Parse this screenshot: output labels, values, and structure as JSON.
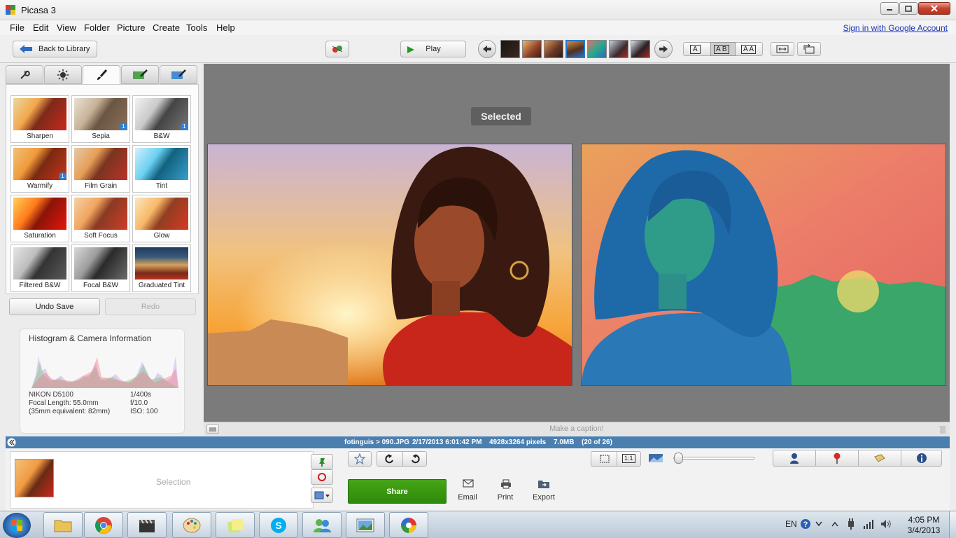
{
  "window": {
    "title": "Picasa 3"
  },
  "menu": {
    "items": [
      "File",
      "Edit",
      "View",
      "Folder",
      "Picture",
      "Create",
      "Tools",
      "Help"
    ],
    "sign_in": "Sign in with Google Account"
  },
  "toolbar": {
    "back_label": "Back to Library",
    "play_label": "Play",
    "view_a": "A",
    "view_ab": "A B",
    "view_aa": "A A"
  },
  "tabs": [
    "basic-fixes",
    "tuning",
    "effects",
    "effects-2",
    "effects-3"
  ],
  "effects": [
    {
      "label": "Sharpen",
      "badge": ""
    },
    {
      "label": "Sepia",
      "badge": "1"
    },
    {
      "label": "B&W",
      "badge": "1"
    },
    {
      "label": "Warmify",
      "badge": "1"
    },
    {
      "label": "Film Grain",
      "badge": ""
    },
    {
      "label": "Tint",
      "badge": ""
    },
    {
      "label": "Saturation",
      "badge": ""
    },
    {
      "label": "Soft Focus",
      "badge": ""
    },
    {
      "label": "Glow",
      "badge": ""
    },
    {
      "label": "Filtered B&W",
      "badge": ""
    },
    {
      "label": "Focal B&W",
      "badge": ""
    },
    {
      "label": "Graduated Tint",
      "badge": ""
    }
  ],
  "edit": {
    "undo_label": "Undo Save",
    "redo_label": "Redo"
  },
  "histogram": {
    "title": "Histogram & Camera Information",
    "camera": "NIKON D5100",
    "focal_length": "Focal Length: 55.0mm",
    "equivalent": "(35mm equivalent:  82mm)",
    "shutter": "1/400s",
    "aperture": "f/10.0",
    "iso": "ISO: 100"
  },
  "preview": {
    "selected_label": "Selected",
    "caption_placeholder": "Make a caption!"
  },
  "info": {
    "path": "fotinguis > 090.JPG",
    "datetime": "2/17/2013 6:01:42 PM",
    "dimensions": "4928x3264 pixels",
    "size": "7.0MB",
    "position": "(20 of 26)"
  },
  "tray": {
    "selection_label": "Selection",
    "share_label": "Share",
    "email_label": "Email",
    "print_label": "Print",
    "export_label": "Export",
    "zoom_one_to_one": "1:1"
  },
  "taskbar": {
    "lang": "EN",
    "time": "4:05 PM",
    "date": "3/4/2013"
  },
  "colors": {
    "accent": "#4a7fb0",
    "share": "#3a9a10",
    "link": "#1a33b8"
  }
}
